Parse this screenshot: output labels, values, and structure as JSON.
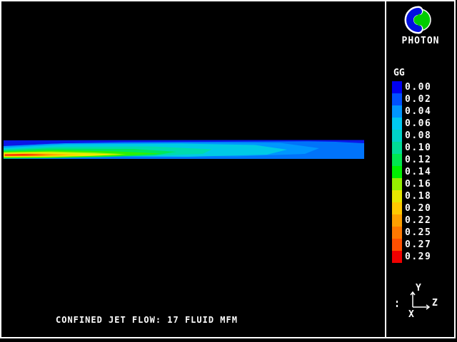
{
  "app": {
    "brand": "PHOTON",
    "accent_blue": "#0010E0",
    "accent_green": "#00CC00"
  },
  "caption": "CONFINED JET FLOW: 17 FLUID MFM",
  "legend": {
    "title": "GG",
    "entries": [
      {
        "value": "0.00",
        "color": "#0000F0"
      },
      {
        "value": "0.02",
        "color": "#0050FF"
      },
      {
        "value": "0.04",
        "color": "#0096FF"
      },
      {
        "value": "0.06",
        "color": "#00C8F0"
      },
      {
        "value": "0.08",
        "color": "#00D2C8"
      },
      {
        "value": "0.10",
        "color": "#00DC96"
      },
      {
        "value": "0.12",
        "color": "#00E650"
      },
      {
        "value": "0.14",
        "color": "#00F000"
      },
      {
        "value": "0.16",
        "color": "#96F000"
      },
      {
        "value": "0.18",
        "color": "#E6E600"
      },
      {
        "value": "0.20",
        "color": "#FFC800"
      },
      {
        "value": "0.22",
        "color": "#FFA000"
      },
      {
        "value": "0.25",
        "color": "#FF7800"
      },
      {
        "value": "0.27",
        "color": "#FF5000"
      },
      {
        "value": "0.29",
        "color": "#F00000"
      }
    ]
  },
  "axes": {
    "y": "Y",
    "z": "Z",
    "x": "X"
  },
  "chart_data": {
    "type": "heatmap",
    "title": "CONFINED JET FLOW: 17 FLUID MFM",
    "variable": "GG",
    "levels": [
      0.0,
      0.02,
      0.04,
      0.06,
      0.08,
      0.1,
      0.12,
      0.14,
      0.16,
      0.18,
      0.2,
      0.22,
      0.25,
      0.27,
      0.29
    ],
    "value_range": [
      0.0,
      0.29
    ],
    "legend_position": "right",
    "description": "Axisymmetric confined jet concentration (GG) contour: peak ~0.29 (red) in thin core at inlet lower-left, decaying through orange/yellow/green to cyan, reaching ~0.00-0.02 (blue) along the top wall and at the outlet on the right; jet axis horizontal along Z."
  }
}
